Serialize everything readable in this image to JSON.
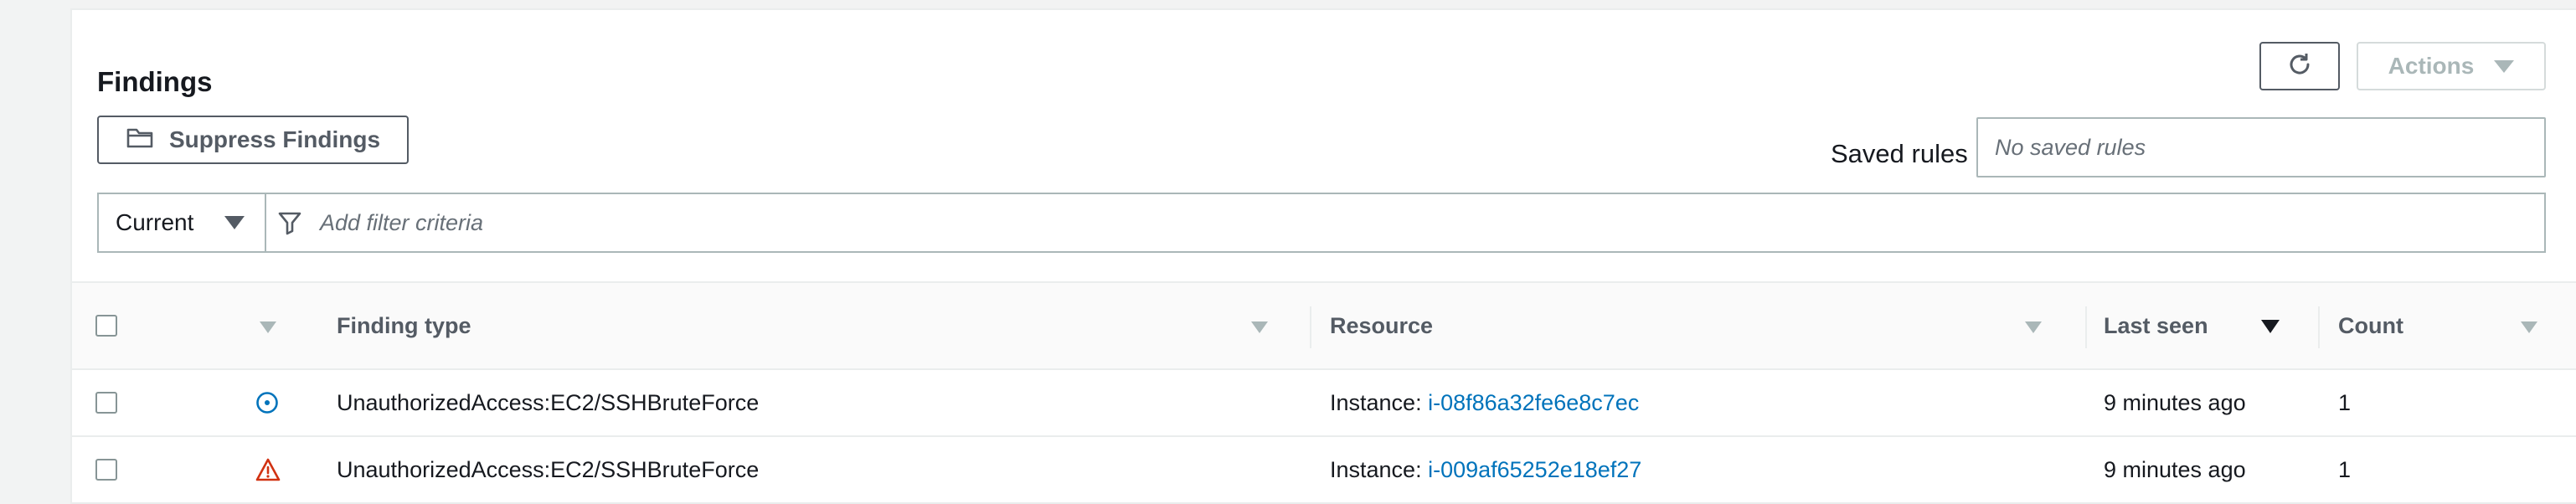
{
  "header": {
    "title": "Findings",
    "actions_label": "Actions",
    "suppress_label": "Suppress Findings"
  },
  "saved_rules": {
    "label": "Saved rules",
    "placeholder": "No saved rules"
  },
  "filter": {
    "current_label": "Current",
    "placeholder": "Add filter criteria"
  },
  "table": {
    "columns": {
      "finding_type": "Finding type",
      "resource": "Resource",
      "last_seen": "Last seen",
      "count": "Count"
    },
    "rows": [
      {
        "severity_icon": "info-circle-icon",
        "finding_type": "UnauthorizedAccess:EC2/SSHBruteForce",
        "resource_prefix": "Instance: ",
        "resource_id": "i-08f86a32fe6e8c7ec",
        "last_seen": "9 minutes ago",
        "count": "1"
      },
      {
        "severity_icon": "warning-triangle-icon",
        "finding_type": "UnauthorizedAccess:EC2/SSHBruteForce",
        "resource_prefix": "Instance: ",
        "resource_id": "i-009af65252e18ef27",
        "last_seen": "9 minutes ago",
        "count": "1"
      }
    ]
  },
  "colors": {
    "link": "#0073bb",
    "low_severity": "#0073bb",
    "high_severity": "#d13212"
  }
}
